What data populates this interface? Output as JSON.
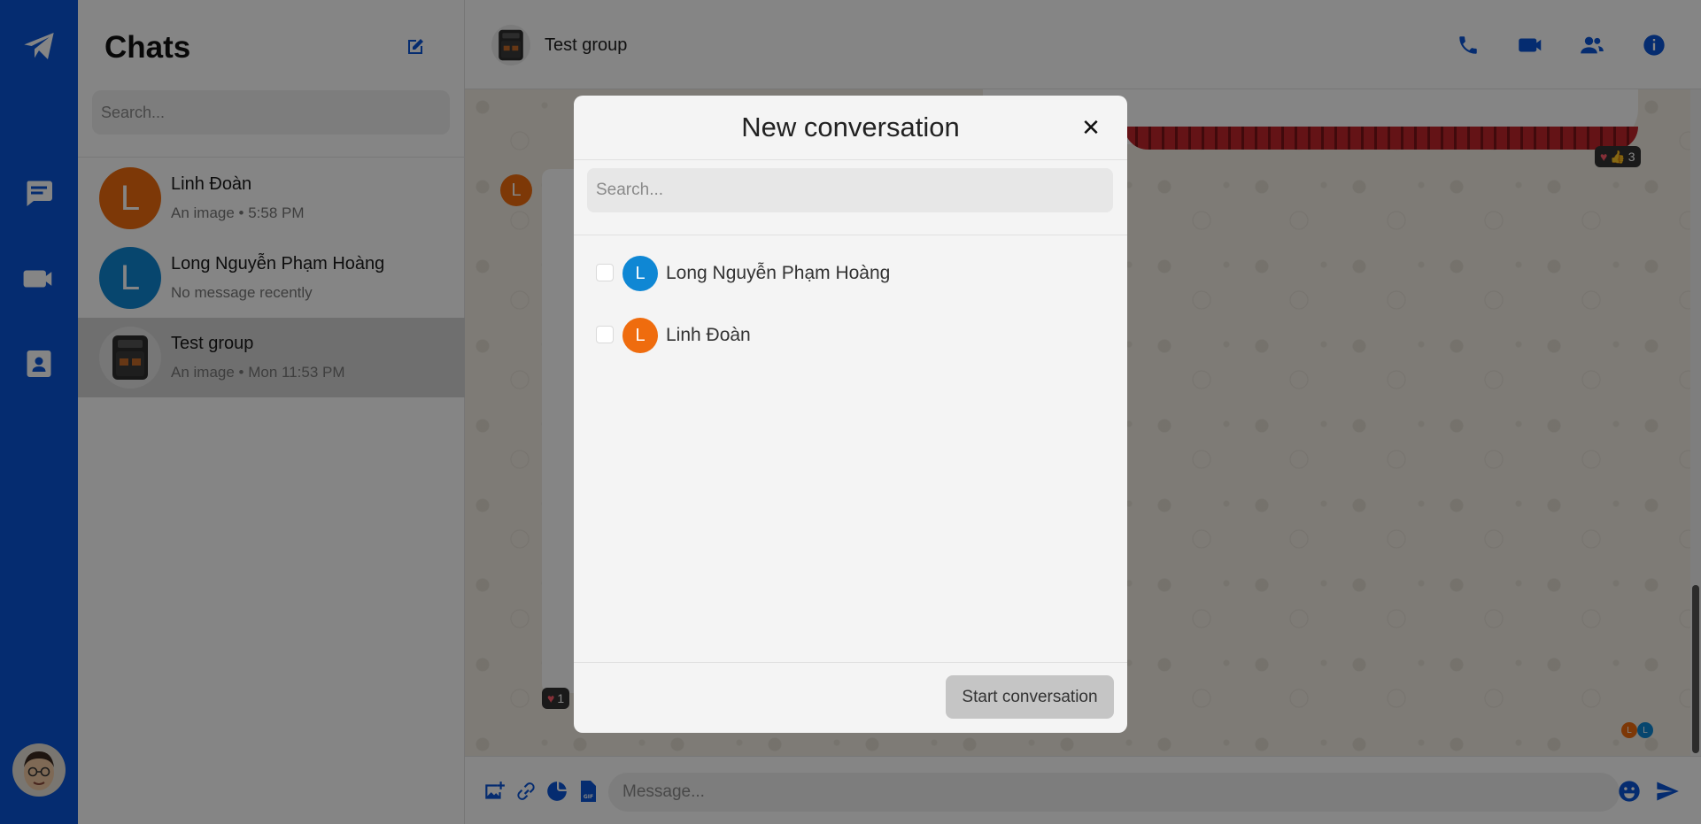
{
  "app": {
    "accent_color": "#0a55d6"
  },
  "rail": {
    "items": [
      {
        "icon": "send-icon"
      },
      {
        "icon": "chat-icon"
      },
      {
        "icon": "video-icon"
      },
      {
        "icon": "contacts-icon"
      }
    ],
    "profile_icon": "avatar-memoji"
  },
  "sidebar": {
    "title": "Chats",
    "search_placeholder": "Search...",
    "chats": [
      {
        "name": "Linh Đoàn",
        "preview": "An image • 5:58 PM",
        "avatar_letter": "L",
        "avatar_color": "#ef6c0e"
      },
      {
        "name": "Long Nguyễn Phạm Hoàng",
        "preview": "No message recently",
        "avatar_letter": "L",
        "avatar_color": "#0f87d4"
      },
      {
        "name": "Test group",
        "preview": "An image • Mon 11:53 PM",
        "avatar_letter": "",
        "avatar_color": "#e4e4e4"
      }
    ]
  },
  "conversation": {
    "title": "Test group",
    "header_icons": [
      "phone-icon",
      "video-call-icon",
      "members-icon",
      "info-icon"
    ],
    "reaction_count_top": "3",
    "reaction_count_bottom": "1",
    "sender_letter": "L",
    "seen_by": [
      {
        "letter": "L",
        "color": "#ef6c0e"
      },
      {
        "letter": "L",
        "color": "#0f87d4"
      }
    ]
  },
  "composer": {
    "placeholder": "Message...",
    "icons": [
      "add-image-icon",
      "link-icon",
      "sticker-icon",
      "gif-icon",
      "emoji-icon",
      "send-icon"
    ]
  },
  "modal": {
    "title": "New conversation",
    "close_symbol": "✕",
    "search_placeholder": "Search...",
    "contacts": [
      {
        "name": "Long Nguyễn Phạm Hoàng",
        "avatar_letter": "L",
        "avatar_color": "#0f87d4",
        "checked": false
      },
      {
        "name": "Linh Đoàn",
        "avatar_letter": "L",
        "avatar_color": "#ef6c0e",
        "checked": false
      }
    ],
    "start_button": "Start conversation"
  }
}
